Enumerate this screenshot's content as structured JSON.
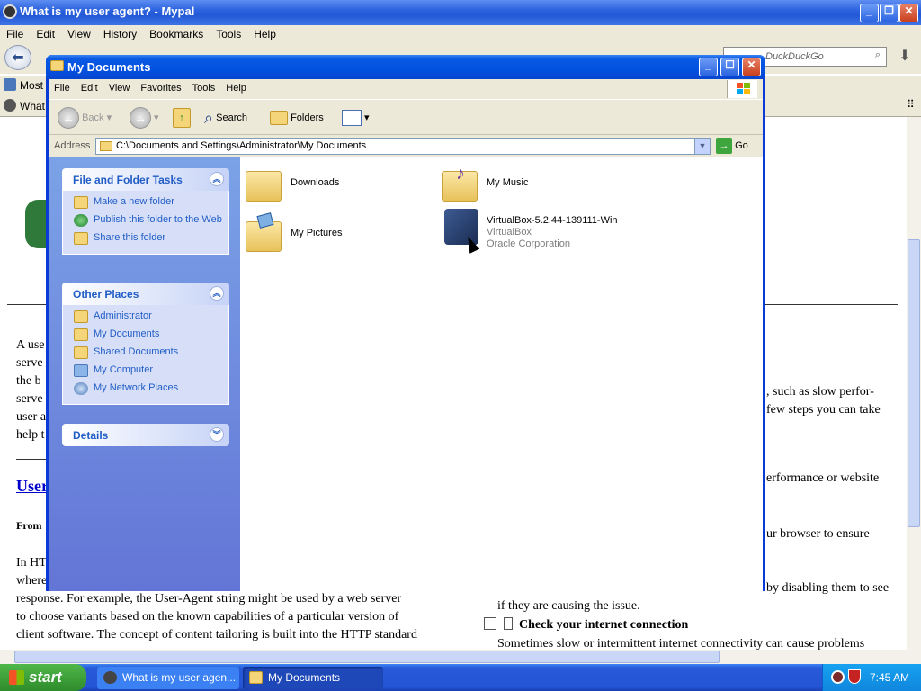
{
  "browser": {
    "title": "What is my user agent? - Mypal",
    "menu": [
      "File",
      "Edit",
      "View",
      "History",
      "Bookmarks",
      "Tools",
      "Help"
    ],
    "search_placeholder": "DuckDuckGo",
    "bookmark_label": "Most V",
    "tab_label": "What",
    "page_lines_left": [
      "A use",
      "serve",
      "the b",
      "serve",
      "user a",
      "help t"
    ],
    "page_heading": "User",
    "page_from": "From",
    "para2_lines": [
      "In HT",
      "where",
      "response. For example, the User-Agent string might be used by a web server",
      "to choose variants based on the known capabilities of a particular version of",
      "client software. The concept of content tailoring is built into the HTTP standard"
    ],
    "right_lines": [
      ", such as slow perfor-",
      "few steps you can take",
      "erformance or website",
      "ur browser to ensure",
      "by disabling them to see",
      "if they are causing the issue."
    ],
    "right_heading": "Check your internet connection",
    "right_last": "Sometimes slow or intermittent internet connectivity can cause problems"
  },
  "explorer": {
    "title": "My Documents",
    "menu": [
      "File",
      "Edit",
      "View",
      "Favorites",
      "Tools",
      "Help"
    ],
    "toolbar": {
      "back": "Back",
      "search": "Search",
      "folders": "Folders"
    },
    "address_label": "Address",
    "address_value": "C:\\Documents and Settings\\Administrator\\My Documents",
    "go_label": "Go",
    "file_tasks": {
      "title": "File and Folder Tasks",
      "items": [
        "Make a new folder",
        "Publish this folder to the Web",
        "Share this folder"
      ]
    },
    "other_places": {
      "title": "Other Places",
      "items": [
        "Administrator",
        "My Documents",
        "Shared Documents",
        "My Computer",
        "My Network Places"
      ]
    },
    "details": {
      "title": "Details"
    },
    "files": [
      {
        "name": "Downloads"
      },
      {
        "name": "My Music"
      },
      {
        "name": "My Pictures"
      },
      {
        "name": "VirtualBox-5.2.44-139111-Win",
        "type": "VirtualBox",
        "company": "Oracle Corporation"
      }
    ]
  },
  "taskbar": {
    "start": "start",
    "tasks": [
      "What is my user agen...",
      "My Documents"
    ],
    "clock": "7:45 AM"
  }
}
